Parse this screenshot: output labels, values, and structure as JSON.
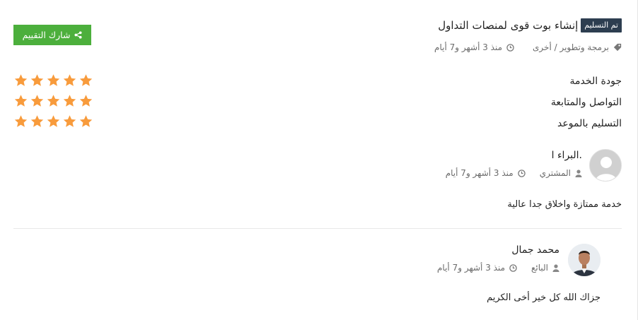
{
  "header": {
    "badge": "تم التسليم",
    "title": "إنشاء بوت قوى لمنصات التداول",
    "category": "برمجة وتطوير / أخرى",
    "time": "منذ 3 أشهر و7 أيام"
  },
  "share_button": {
    "label": "شارك التقييم",
    "color": "#4caf3c"
  },
  "ratings": [
    {
      "label": "جودة الخدمة",
      "stars": 5
    },
    {
      "label": "التواصل والمتابعة",
      "stars": 5
    },
    {
      "label": "التسليم بالموعد",
      "stars": 5
    }
  ],
  "star_color": "#f89b3c",
  "reviews": [
    {
      "name": "البراء ا.",
      "role": "المشتري",
      "time": "منذ 3 أشهر و7 أيام",
      "text": "خدمة ممتازة واخلاق جدا عالية"
    },
    {
      "name": "محمد جمال",
      "role": "البائع",
      "time": "منذ 3 أشهر و7 أيام",
      "text": "جزاك الله كل خير أخى الكريم"
    }
  ]
}
